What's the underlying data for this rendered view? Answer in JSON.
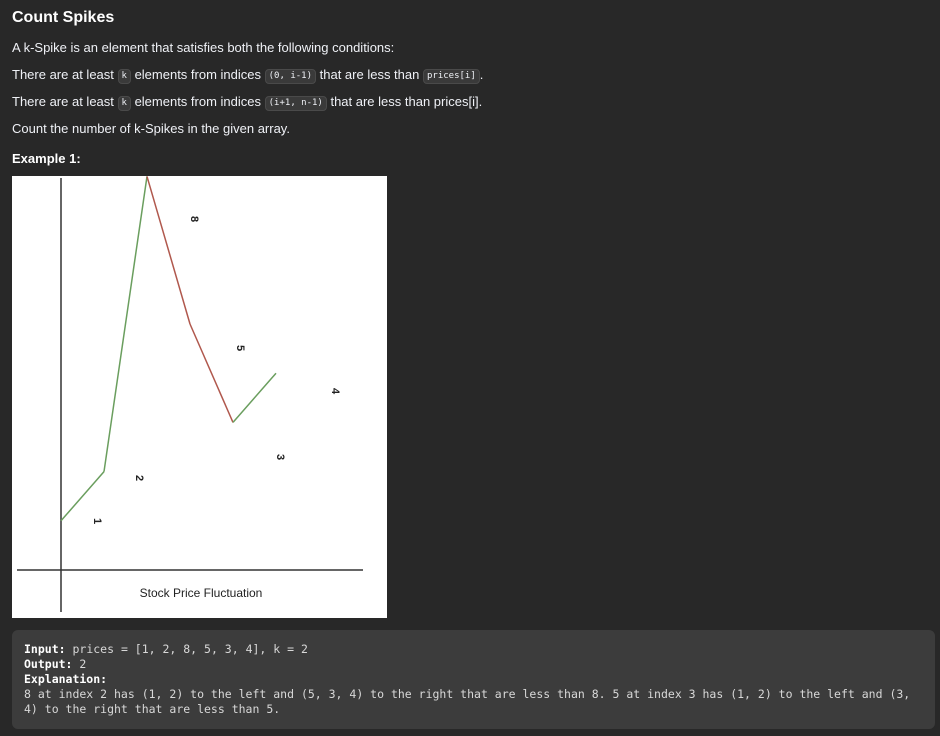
{
  "problem": {
    "title": "Count Spikes",
    "intro": "A k-Spike is an element that satisfies both the following conditions:",
    "cond1": {
      "a": "There are at least",
      "k": "k",
      "b": "elements from indices",
      "range": "(0, i-1)",
      "c": "that are less than",
      "price": "prices[i]",
      "d": "."
    },
    "cond2": {
      "a": "There are at least",
      "k": "k",
      "b": "elements from indices",
      "range": "(i+1, n-1)",
      "c": "that are less than prices[i]."
    },
    "task": "Count the number of k-Spikes in the given array."
  },
  "example": {
    "title": "Example 1:",
    "input_label": "Input:",
    "input_value": "prices = [1, 2, 8, 5, 3, 4], k = 2",
    "output_label": "Output:",
    "output_value": "2",
    "explanation_label": "Explanation:",
    "explanation_text": "8 at index 2 has (1, 2) to the left and (5, 3, 4) to the right that are less than 8. 5 at index 3 has (1, 2) to the left and (3, 4) to the right that are less than 5."
  },
  "colors": {
    "rising": "#6a9e5e",
    "falling": "#b0584d",
    "axis": "#333333"
  },
  "chart_data": {
    "type": "line",
    "title": "",
    "xlabel": "Stock Price Fluctuation",
    "ylabel": "",
    "x": [
      0,
      1,
      2,
      3,
      4,
      5
    ],
    "values": [
      1,
      2,
      8,
      5,
      3,
      4
    ],
    "point_labels": [
      "1",
      "2",
      "8",
      "5",
      "3",
      "4"
    ],
    "segment_colors": [
      "rising",
      "rising",
      "falling",
      "falling",
      "rising"
    ],
    "grid": false
  }
}
